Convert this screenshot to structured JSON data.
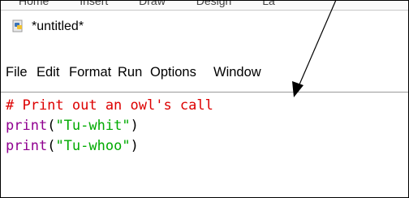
{
  "ribbon": {
    "tabs": [
      "Home",
      "Insert",
      "Draw",
      "Design",
      "La"
    ]
  },
  "window": {
    "title": "*untitled*",
    "icon": "python-file-icon"
  },
  "menu": {
    "items": [
      "File",
      "Edit",
      "Format",
      "Run",
      "Options",
      "Window"
    ]
  },
  "editor": {
    "line1": {
      "comment": "# Print out an owl's call"
    },
    "line2": {
      "builtin": "print",
      "open": "(",
      "string": "\"Tu-whit\"",
      "close": ")"
    },
    "line3": {
      "builtin": "print",
      "open": "(",
      "string": "\"Tu-whoo\"",
      "close": ")"
    }
  },
  "colors": {
    "comment": "#dd0000",
    "builtin": "#900090",
    "string": "#00aa00",
    "annotation_arrow": "#000000"
  }
}
